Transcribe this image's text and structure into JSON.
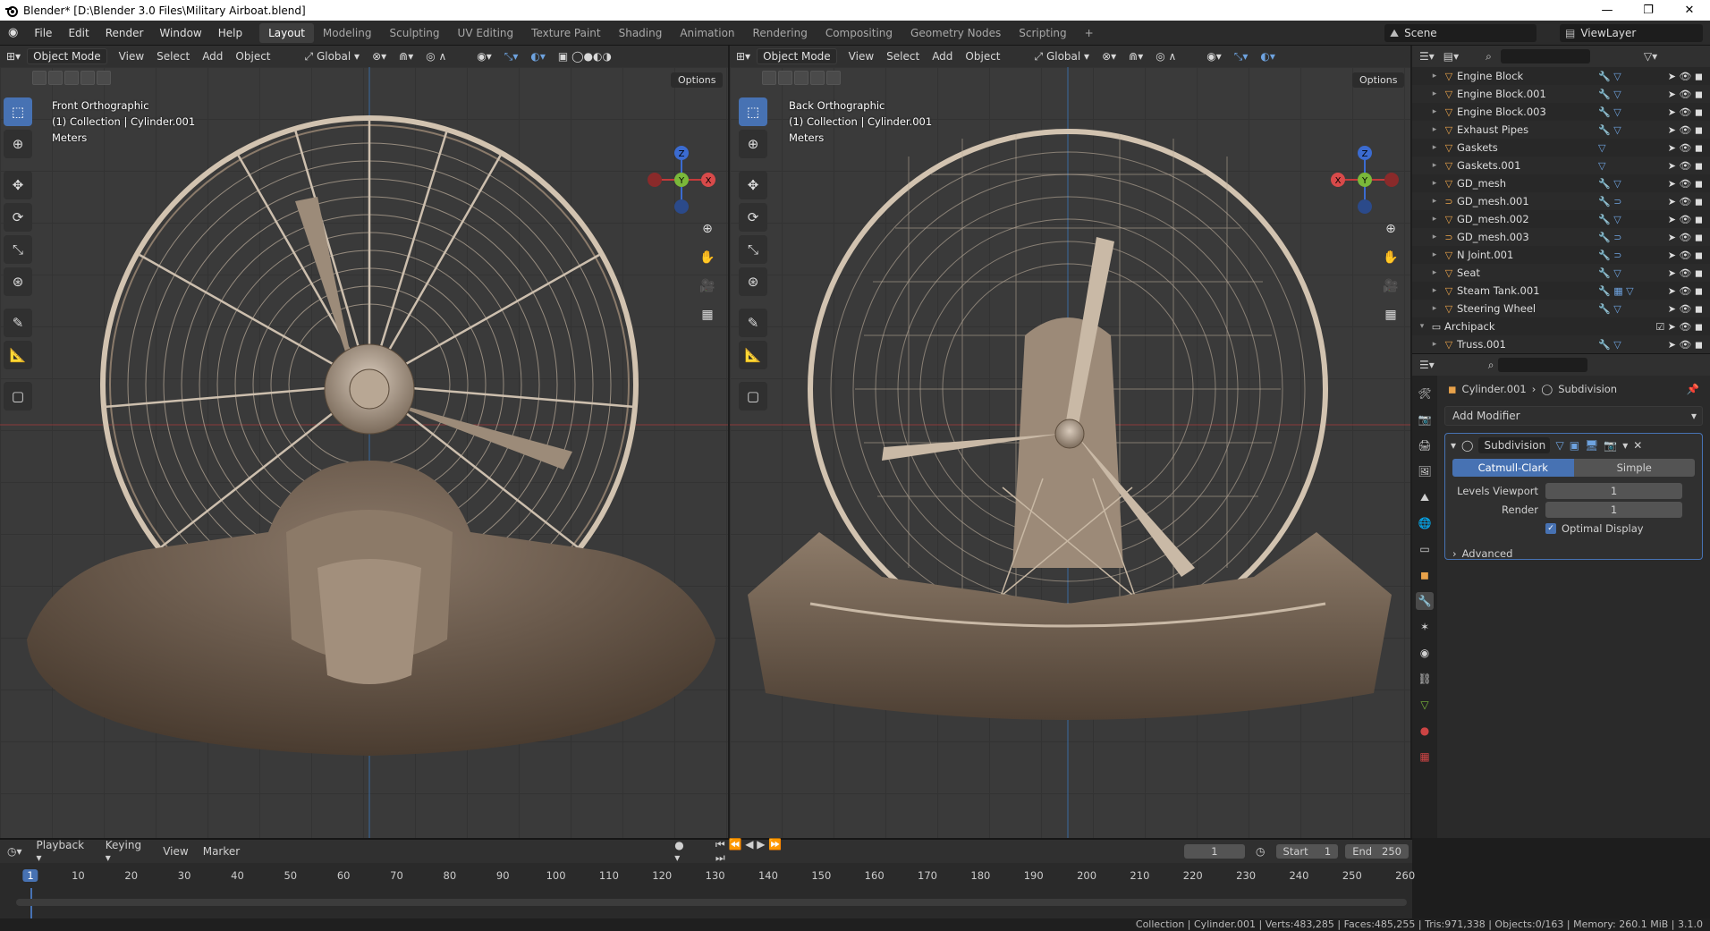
{
  "window": {
    "title": "Blender* [D:\\Blender 3.0 Files\\Military Airboat.blend]",
    "min": "—",
    "max": "❐",
    "close": "✕"
  },
  "menu": [
    "File",
    "Edit",
    "Render",
    "Window",
    "Help"
  ],
  "workspaces": [
    "Layout",
    "Modeling",
    "Sculpting",
    "UV Editing",
    "Texture Paint",
    "Shading",
    "Animation",
    "Rendering",
    "Compositing",
    "Geometry Nodes",
    "Scripting",
    "+"
  ],
  "scene": {
    "name": "Scene",
    "view_layer": "ViewLayer"
  },
  "viewport_left": {
    "mode": "Object Mode",
    "menus": [
      "View",
      "Select",
      "Add",
      "Object"
    ],
    "orientation": "Global",
    "options": "Options",
    "view_name": "Front Orthographic",
    "collection": "(1) Collection | Cylinder.001",
    "units": "Meters"
  },
  "viewport_right": {
    "mode": "Object Mode",
    "menus": [
      "View",
      "Select",
      "Add",
      "Object"
    ],
    "orientation": "Global",
    "options": "Options",
    "view_name": "Back Orthographic",
    "collection": "(1) Collection | Cylinder.001",
    "units": "Meters"
  },
  "gizmo": {
    "z": "Z",
    "y": "Y",
    "x": "X"
  },
  "outliner": {
    "items": [
      "Engine Block",
      "Engine Block.001",
      "Engine Block.003",
      "Exhaust Pipes",
      "Gaskets",
      "Gaskets.001",
      "GD_mesh",
      "GD_mesh.001",
      "GD_mesh.002",
      "GD_mesh.003",
      "N Joint.001",
      "Seat",
      "Steam Tank.001",
      "Steering Wheel",
      "Archipack",
      "Truss.001"
    ]
  },
  "properties": {
    "object": "Cylinder.001",
    "modifier_crumb": "Subdivision",
    "add_modifier": "Add Modifier",
    "modifier_name": "Subdivision",
    "mode_a": "Catmull-Clark",
    "mode_b": "Simple",
    "levels_viewport_label": "Levels Viewport",
    "levels_viewport": "1",
    "render_label": "Render",
    "render": "1",
    "optimal_display": "Optimal Display",
    "advanced": "Advanced"
  },
  "timeline": {
    "menus": [
      "Playback",
      "Keying",
      "View",
      "Marker"
    ],
    "current": "1",
    "start_label": "Start",
    "start": "1",
    "end_label": "End",
    "end": "250",
    "ticks": [
      "1",
      "10",
      "20",
      "30",
      "40",
      "50",
      "60",
      "70",
      "80",
      "90",
      "100",
      "110",
      "120",
      "130",
      "140",
      "150",
      "160",
      "170",
      "180",
      "190",
      "200",
      "210",
      "220",
      "230",
      "240",
      "250",
      "260"
    ]
  },
  "status": {
    "text": "Collection | Cylinder.001 | Verts:483,285 | Faces:485,255 | Tris:971,338 | Objects:0/163 | Memory: 260.1 MiB | 3.1.0"
  }
}
